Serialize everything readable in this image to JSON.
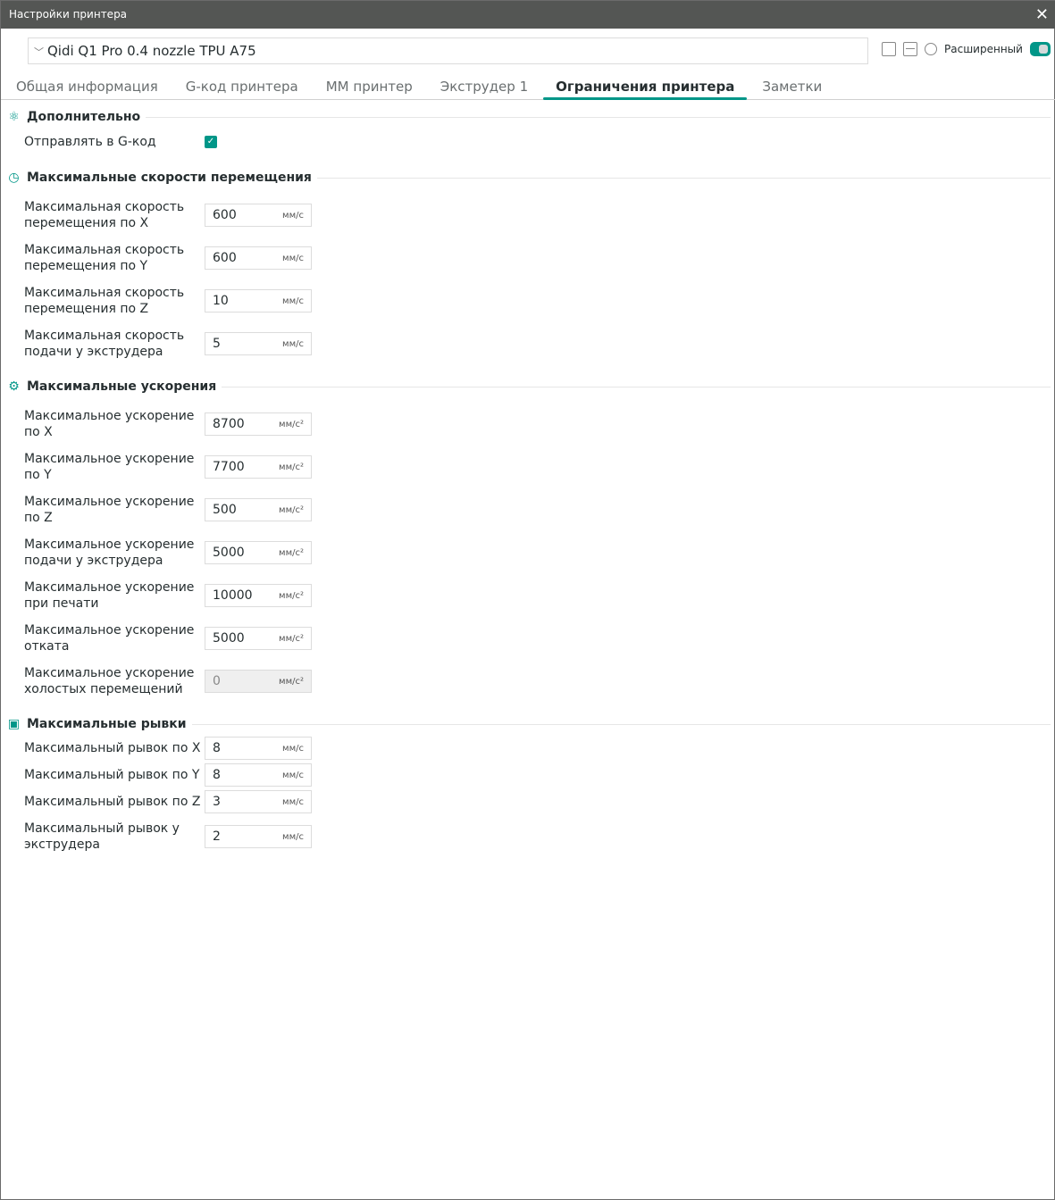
{
  "window": {
    "title": "Настройки принтера"
  },
  "preset": {
    "name": "Qidi Q1 Pro 0.4 nozzle TPU A75"
  },
  "toolbar": {
    "mode_label": "Расширенный",
    "mode_on": true
  },
  "tabs": [
    "Общая информация",
    "G-код принтера",
    "ММ принтер",
    "Экструдер 1",
    "Ограничения принтера",
    "Заметки"
  ],
  "active_tab": 4,
  "sections": [
    {
      "title": "Дополнительно",
      "icon": "atom-icon",
      "rows": [
        {
          "label": "Отправлять в G-код",
          "type": "checkbox",
          "checked": true
        }
      ]
    },
    {
      "title": "Максимальные скорости перемещения",
      "icon": "speedometer-icon",
      "rows": [
        {
          "label": "Максимальная скорость перемещения по X",
          "value": "600",
          "unit": "мм/с"
        },
        {
          "label": "Максимальная скорость перемещения по Y",
          "value": "600",
          "unit": "мм/с"
        },
        {
          "label": "Максимальная скорость перемещения по Z",
          "value": "10",
          "unit": "мм/с"
        },
        {
          "label": "Максимальная скорость подачи у экструдера",
          "value": "5",
          "unit": "мм/с"
        }
      ]
    },
    {
      "title": "Максимальные ускорения",
      "icon": "acceleration-icon",
      "rows": [
        {
          "label": "Максимальное ускорение по X",
          "value": "8700",
          "unit": "мм/с²"
        },
        {
          "label": "Максимальное ускорение по Y",
          "value": "7700",
          "unit": "мм/с²"
        },
        {
          "label": "Максимальное ускорение по Z",
          "value": "500",
          "unit": "мм/с²"
        },
        {
          "label": "Максимальное ускорение подачи у экструдера",
          "value": "5000",
          "unit": "мм/с²"
        },
        {
          "label": "Максимальное ускорение при печати",
          "value": "10000",
          "unit": "мм/с²"
        },
        {
          "label": "Максимальное ускорение отката",
          "value": "5000",
          "unit": "мм/с²"
        },
        {
          "label": "Максимальное ускорение холостых перемещений",
          "value": "0",
          "unit": "мм/с²",
          "disabled": true
        }
      ]
    },
    {
      "title": "Максимальные рывки",
      "icon": "jerk-icon",
      "rows": [
        {
          "label": "Максимальный рывок по X",
          "value": "8",
          "unit": "мм/с"
        },
        {
          "label": "Максимальный рывок по Y",
          "value": "8",
          "unit": "мм/с"
        },
        {
          "label": "Максимальный рывок по Z",
          "value": "3",
          "unit": "мм/с"
        },
        {
          "label": "Максимальный рывок у экструдера",
          "value": "2",
          "unit": "мм/с"
        }
      ]
    }
  ]
}
